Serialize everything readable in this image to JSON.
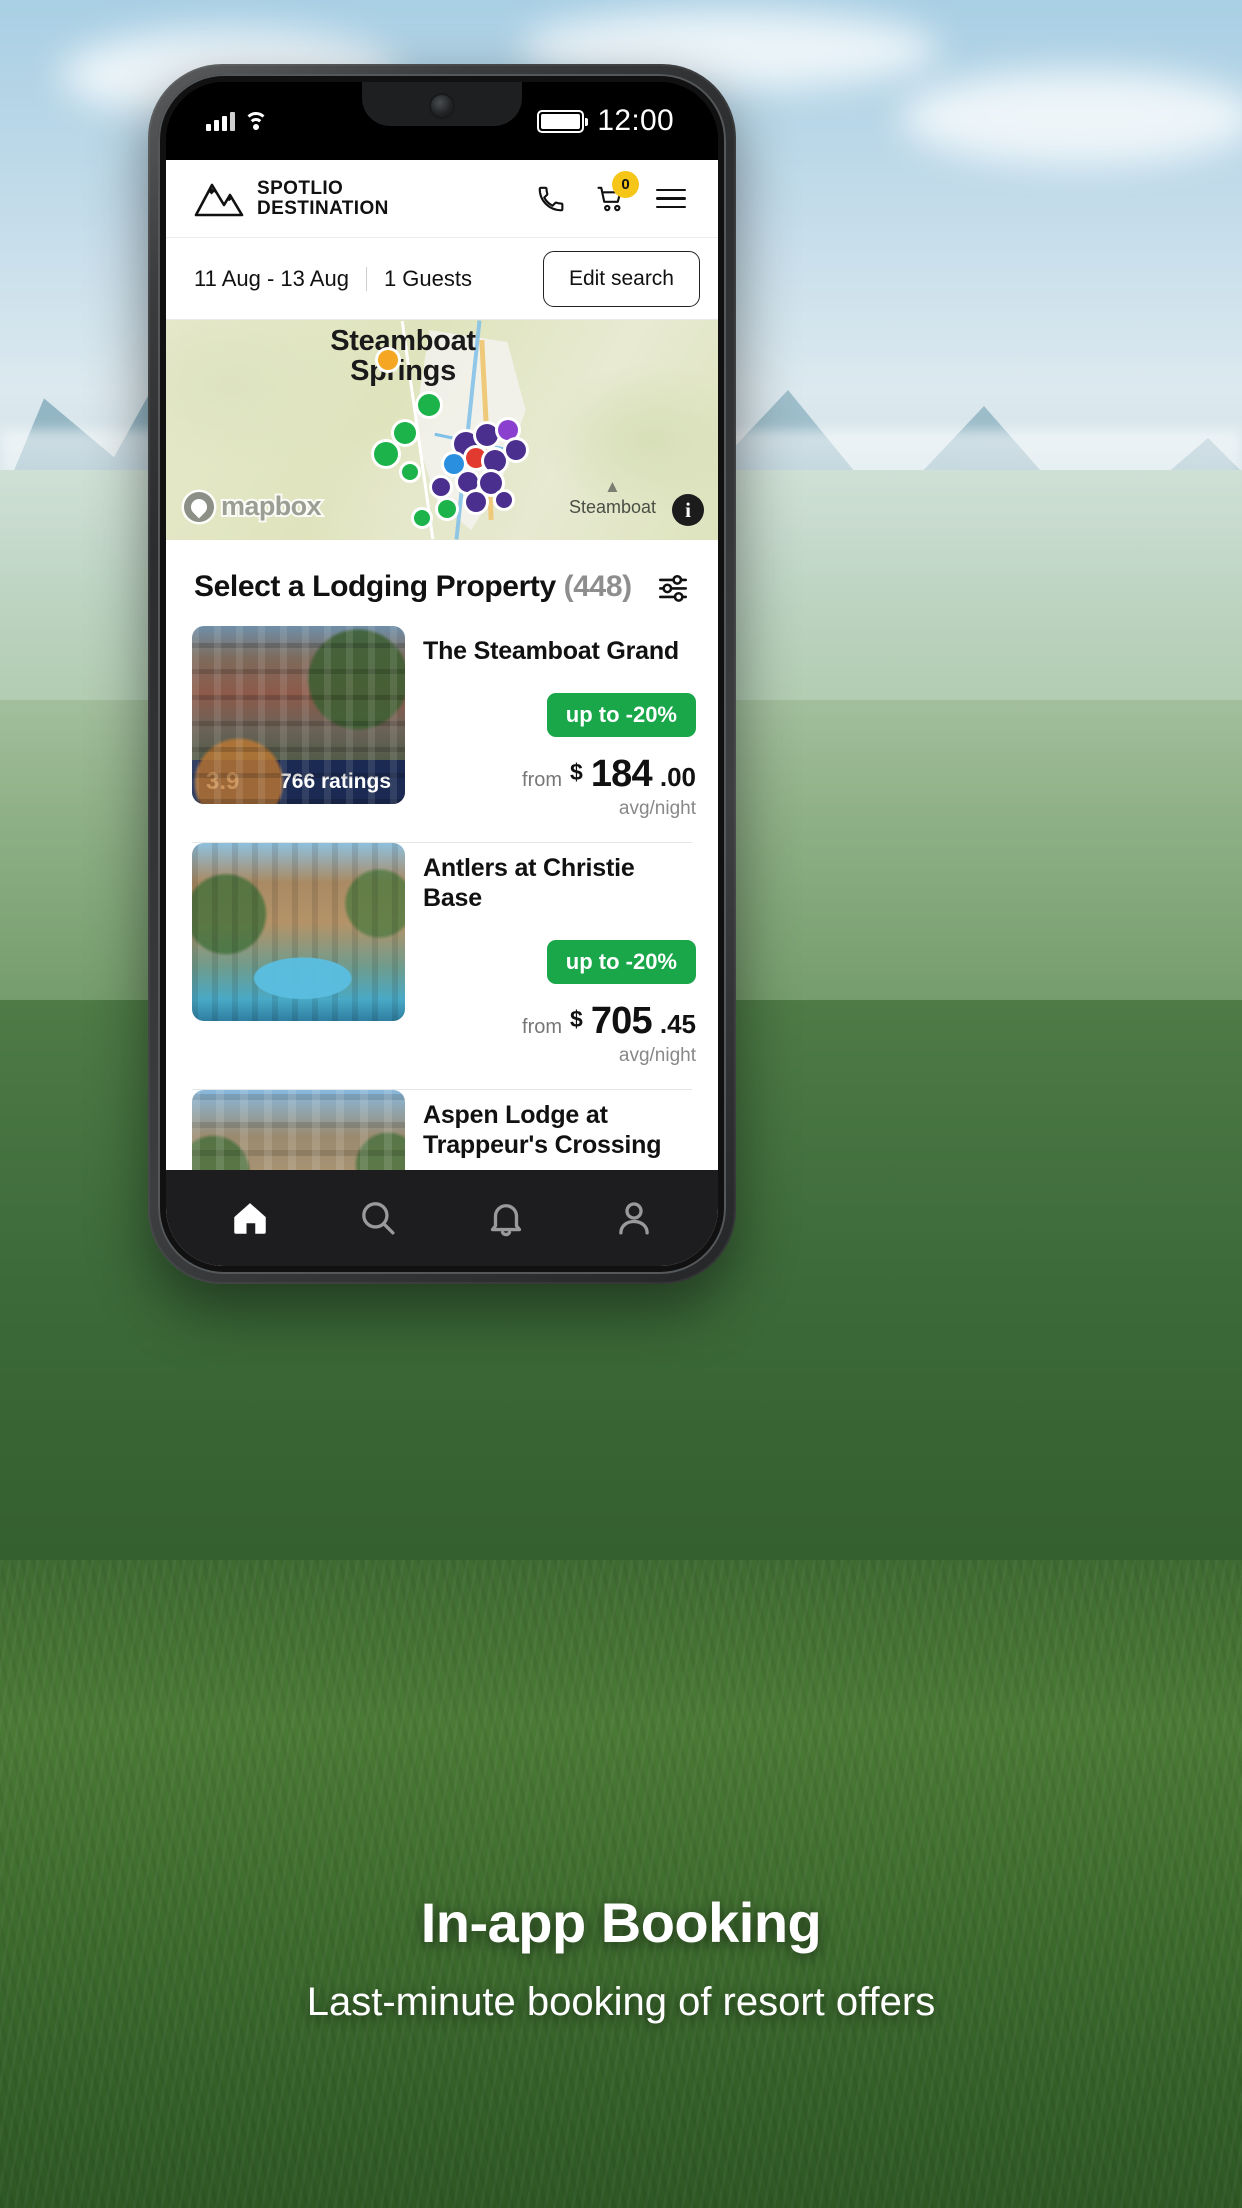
{
  "status_bar": {
    "signal_icon": "cellular-signal-icon",
    "wifi_icon": "wifi-icon",
    "battery_icon": "battery-full-icon",
    "time": "12:00"
  },
  "app_bar": {
    "logo_icon": "mountain-logo-icon",
    "brand_line1": "SPOTLIO",
    "brand_line2": "DESTINATION",
    "phone_icon": "phone-icon",
    "cart_icon": "shopping-cart-icon",
    "cart_count": "0",
    "menu_icon": "hamburger-menu-icon"
  },
  "search": {
    "dates": "11 Aug - 13 Aug",
    "guests": "1 Guests",
    "edit_label": "Edit search"
  },
  "map": {
    "label_line1": "Steamboat",
    "label_line2": "Springs",
    "attribution": "mapbox",
    "place_icon": "mountain-place-icon",
    "place_name": "Steamboat",
    "info_icon": "info-icon",
    "info_glyph": "i",
    "pin_colors": {
      "green": "#1bb34a",
      "purple": "#4b2f8f",
      "violet": "#8b3fcf",
      "blue": "#2b8fe0",
      "red": "#e23a2e",
      "orange": "#f5a623"
    }
  },
  "list": {
    "title": "Select a Lodging Property",
    "count": "(448)",
    "filter_icon": "filter-sliders-icon",
    "properties": [
      {
        "name": "The Steamboat Grand",
        "rating": "3.9",
        "ratings_label": "766 ratings",
        "discount": "up to -20%",
        "from_label": "from",
        "currency": "$",
        "amount": "184",
        "cents": ".00",
        "per_night": "avg/night",
        "has_rating_bar": true
      },
      {
        "name": "Antlers at Christie Base",
        "rating": "",
        "ratings_label": "",
        "discount": "up to -20%",
        "from_label": "from",
        "currency": "$",
        "amount": "705",
        "cents": ".45",
        "per_night": "avg/night",
        "has_rating_bar": false
      },
      {
        "name": "Aspen Lodge at Trappeur's Crossing",
        "rating": "",
        "ratings_label": "",
        "discount": "",
        "from_label": "",
        "currency": "",
        "amount": "",
        "cents": "",
        "per_night": "",
        "has_rating_bar": false
      }
    ]
  },
  "bottom_nav": [
    {
      "icon": "home-icon",
      "active": true
    },
    {
      "icon": "search-icon",
      "active": false
    },
    {
      "icon": "bell-icon",
      "active": false
    },
    {
      "icon": "user-profile-icon",
      "active": false
    }
  ],
  "caption": {
    "title": "In-app Booking",
    "subtitle": "Last-minute booking of resort offers"
  },
  "colors": {
    "discount_green": "#19a74a",
    "rating_navy": "#1b2a52",
    "cart_badge_yellow": "#f5c518",
    "text_dark": "#111111"
  }
}
